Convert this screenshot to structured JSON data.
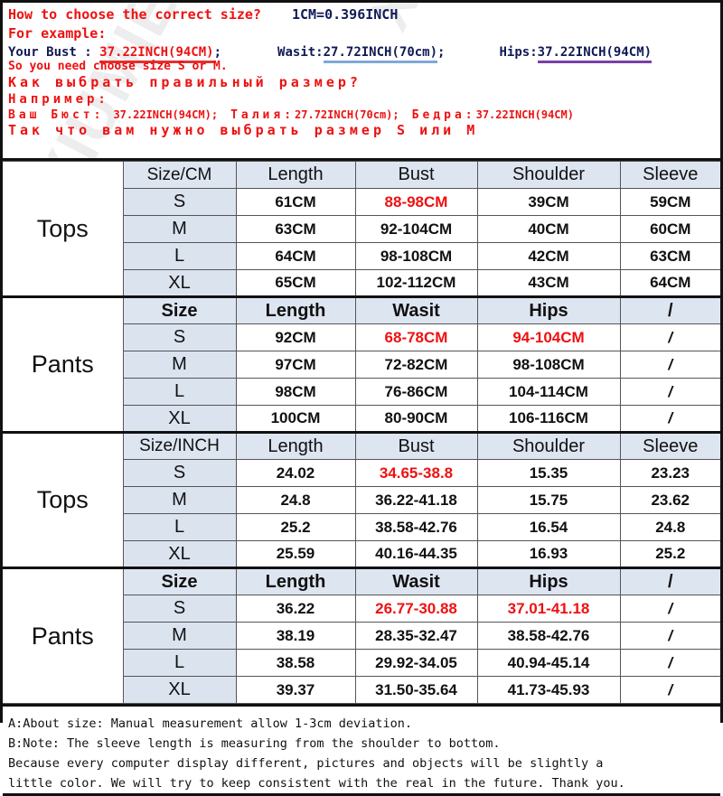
{
  "watermark": {
    "text": "XIUMIEW"
  },
  "intro": {
    "title": "How to choose the correct size?",
    "conversion": "1CM=0.396INCH",
    "for_example": "For example:",
    "bust_label": "Your Bust : ",
    "bust_value": "37.22INCH(94CM)",
    "bust_semicolon": ";",
    "waist_label": "Wasit:",
    "waist_value": "27.72INCH(70cm)",
    "waist_semicolon": ";",
    "hips_label": "Hips:",
    "hips_value": "37.22INCH(94CM)",
    "advice_pre": "So you need choose size ",
    "advice_s": "S",
    "advice_or": " or ",
    "advice_m": "M",
    "advice_end": ".",
    "ru_title": "Как выбрать правильный размер?",
    "ru_for_example": "Например:",
    "ru_bust_label": "Ваш Бюст:",
    "ru_bust_value": "37.22INCH(94CM)",
    "ru_sep1": ";",
    "ru_waist_label": "Талия:",
    "ru_waist_value": "27.72INCH(70cm)",
    "ru_sep2": ";",
    "ru_hips_label": "Бедра:",
    "ru_hips_value": "37.22INCH(94CM)",
    "ru_advice_pre": "Так что вам нужно выбрать размер ",
    "ru_advice_s": "S",
    "ru_advice_or": " или ",
    "ru_advice_m": "M"
  },
  "colors": {
    "red": "#ee1111",
    "navy": "#101a55",
    "header_bg": "#dde5f0",
    "size_bg": "#dbe3ef",
    "underline_red": "#e23030",
    "underline_blue": "#7fa8d8",
    "underline_purple": "#7a3fa8"
  },
  "tables": [
    {
      "category": "Tops",
      "unit_header": "Size/CM",
      "unit_header_red": true,
      "headers_bold": false,
      "columns": [
        "Length",
        "Bust",
        "Shoulder",
        "Sleeve"
      ],
      "rows": [
        {
          "size": "S",
          "values": [
            "61CM",
            "88-98CM",
            "39CM",
            "59CM"
          ],
          "highlight": [
            false,
            true,
            false,
            false
          ]
        },
        {
          "size": "M",
          "values": [
            "63CM",
            "92-104CM",
            "40CM",
            "60CM"
          ],
          "highlight": [
            false,
            false,
            false,
            false
          ]
        },
        {
          "size": "L",
          "values": [
            "64CM",
            "98-108CM",
            "42CM",
            "63CM"
          ],
          "highlight": [
            false,
            false,
            false,
            false
          ]
        },
        {
          "size": "XL",
          "values": [
            "65CM",
            "102-112CM",
            "43CM",
            "64CM"
          ],
          "highlight": [
            false,
            false,
            false,
            false
          ]
        }
      ]
    },
    {
      "category": "Pants",
      "unit_header": "Size",
      "unit_header_red": false,
      "headers_bold": true,
      "columns": [
        "Length",
        "Wasit",
        "Hips",
        "/"
      ],
      "rows": [
        {
          "size": "S",
          "values": [
            "92CM",
            "68-78CM",
            "94-104CM",
            "/"
          ],
          "highlight": [
            false,
            true,
            true,
            false
          ]
        },
        {
          "size": "M",
          "values": [
            "97CM",
            "72-82CM",
            "98-108CM",
            "/"
          ],
          "highlight": [
            false,
            false,
            false,
            false
          ]
        },
        {
          "size": "L",
          "values": [
            "98CM",
            "76-86CM",
            "104-114CM",
            "/"
          ],
          "highlight": [
            false,
            false,
            false,
            false
          ]
        },
        {
          "size": "XL",
          "values": [
            "100CM",
            "80-90CM",
            "106-116CM",
            "/"
          ],
          "highlight": [
            false,
            false,
            false,
            false
          ]
        }
      ]
    },
    {
      "category": "Tops",
      "unit_header": "Size/INCH",
      "unit_header_red": true,
      "headers_bold": false,
      "columns": [
        "Length",
        "Bust",
        "Shoulder",
        "Sleeve"
      ],
      "rows": [
        {
          "size": "S",
          "values": [
            "24.02",
            "34.65-38.8",
            "15.35",
            "23.23"
          ],
          "highlight": [
            false,
            true,
            false,
            false
          ]
        },
        {
          "size": "M",
          "values": [
            "24.8",
            "36.22-41.18",
            "15.75",
            "23.62"
          ],
          "highlight": [
            false,
            false,
            false,
            false
          ]
        },
        {
          "size": "L",
          "values": [
            "25.2",
            "38.58-42.76",
            "16.54",
            "24.8"
          ],
          "highlight": [
            false,
            false,
            false,
            false
          ]
        },
        {
          "size": "XL",
          "values": [
            "25.59",
            "40.16-44.35",
            "16.93",
            "25.2"
          ],
          "highlight": [
            false,
            false,
            false,
            false
          ]
        }
      ]
    },
    {
      "category": "Pants",
      "unit_header": "Size",
      "unit_header_red": false,
      "headers_bold": true,
      "columns": [
        "Length",
        "Wasit",
        "Hips",
        "/"
      ],
      "rows": [
        {
          "size": "S",
          "values": [
            "36.22",
            "26.77-30.88",
            "37.01-41.18",
            "/"
          ],
          "highlight": [
            false,
            true,
            true,
            false
          ]
        },
        {
          "size": "M",
          "values": [
            "38.19",
            "28.35-32.47",
            "38.58-42.76",
            "/"
          ],
          "highlight": [
            false,
            false,
            false,
            false
          ]
        },
        {
          "size": "L",
          "values": [
            "38.58",
            "29.92-34.05",
            "40.94-45.14",
            "/"
          ],
          "highlight": [
            false,
            false,
            false,
            false
          ]
        },
        {
          "size": "XL",
          "values": [
            "39.37",
            "31.50-35.64",
            "41.73-45.93",
            "/"
          ],
          "highlight": [
            false,
            false,
            false,
            false
          ]
        }
      ]
    }
  ],
  "notes": [
    "A:About size: Manual measurement allow 1-3cm deviation.",
    "B:Note: The sleeve length is measuring from the shoulder to bottom.",
    "Because every computer display different, pictures and objects will be slightly a",
    "little color. We will try to keep consistent with the real in the future. Thank you."
  ]
}
